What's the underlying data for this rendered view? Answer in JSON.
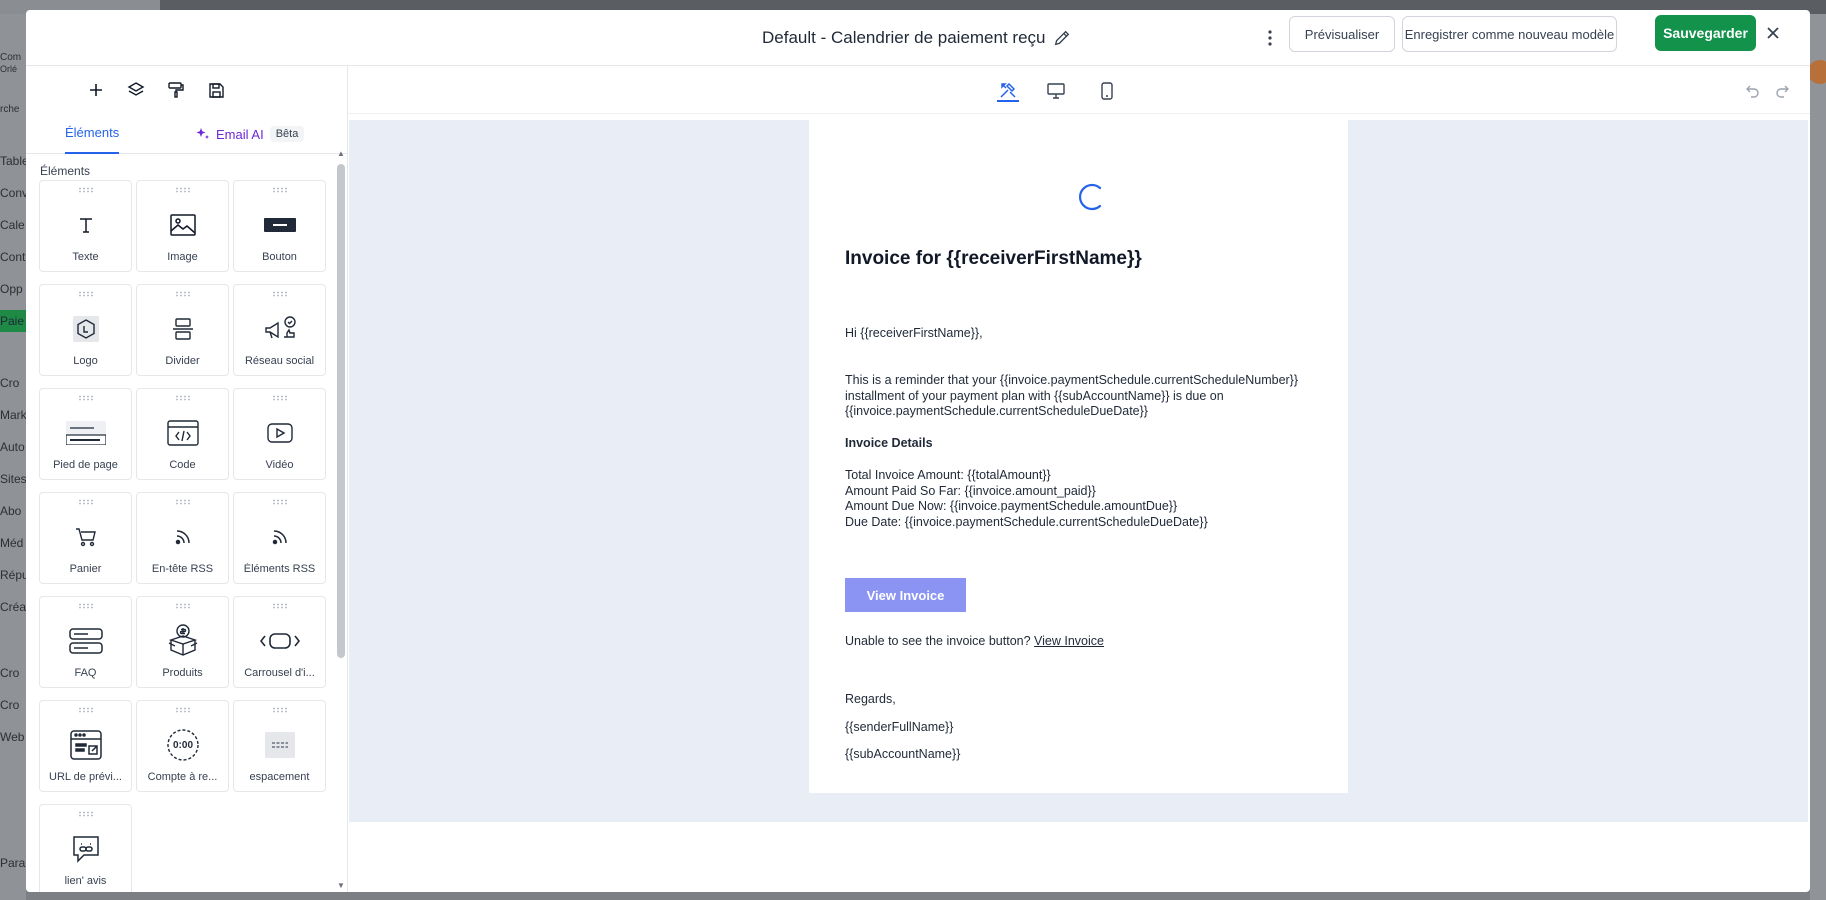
{
  "background": {
    "sidebar_fragments": [
      "Table",
      "Conv",
      "Cale",
      "Cont",
      "Opp",
      "Paie",
      "Cro",
      "Mark",
      "Auto",
      "Sites",
      "Abo",
      "Méd",
      "Répu",
      "Créa",
      "Cro",
      "Cro",
      "Web",
      "Para"
    ],
    "crumb": [
      "Com",
      "Orlé",
      "rche"
    ]
  },
  "header": {
    "title": "Default - Calendrier de paiement reçu",
    "preview_label": "Prévisualiser",
    "save_as_template_label": "Enregistrer comme nouveau modèle",
    "save_label": "Sauvegarder"
  },
  "left_panel": {
    "tab_elements": "Éléments",
    "tab_email_ai": "Email AI",
    "beta_badge": "Bêta",
    "section_label": "Éléments",
    "elements": [
      {
        "label": "Texte",
        "icon": "text-icon"
      },
      {
        "label": "Image",
        "icon": "image-icon"
      },
      {
        "label": "Bouton",
        "icon": "button-icon"
      },
      {
        "label": "Logo",
        "icon": "logo-icon"
      },
      {
        "label": "Divider",
        "icon": "divider-icon"
      },
      {
        "label": "Réseau social",
        "icon": "social-icon"
      },
      {
        "label": "Pied de page",
        "icon": "footer-icon"
      },
      {
        "label": "Code",
        "icon": "code-icon"
      },
      {
        "label": "Vidéo",
        "icon": "video-icon"
      },
      {
        "label": "Panier",
        "icon": "cart-icon"
      },
      {
        "label": "En-tête RSS",
        "icon": "rss-icon"
      },
      {
        "label": "Éléments RSS",
        "icon": "rss-icon"
      },
      {
        "label": "FAQ",
        "icon": "faq-icon"
      },
      {
        "label": "Produits",
        "icon": "products-icon"
      },
      {
        "label": "Carrousel d'i...",
        "icon": "carousel-icon"
      },
      {
        "label": "URL de prévi...",
        "icon": "preview-url-icon"
      },
      {
        "label": "Compte à re...",
        "icon": "countdown-icon"
      },
      {
        "label": "espacement",
        "icon": "spacer-icon"
      },
      {
        "label": "lien' avis",
        "icon": "review-link-icon"
      }
    ],
    "countdown_text": "0:00"
  },
  "email": {
    "title": "Invoice for {{receiverFirstName}}",
    "greeting": "Hi {{receiverFirstName}},",
    "reminder_line1": "This is a reminder that your {{invoice.paymentSchedule.currentScheduleNumber}}",
    "reminder_line2": "installment of your payment plan with {{subAccountName}} is due on",
    "reminder_line3": "{{invoice.paymentSchedule.currentScheduleDueDate}}",
    "details_heading": "Invoice Details",
    "detail_total": "Total Invoice Amount: {{totalAmount}}",
    "detail_paid": "Amount Paid So Far: {{invoice.amount_paid}}",
    "detail_due": "Amount Due Now: {{invoice.paymentSchedule.amountDue}}",
    "detail_date": "Due Date: {{invoice.paymentSchedule.currentScheduleDueDate}}",
    "button_label": "View Invoice",
    "fallback_text": "Unable to see the invoice button?",
    "fallback_link": "View Invoice",
    "regards": "Regards,",
    "sender": "{{senderFullName}}",
    "subaccount": "{{subAccountName}}"
  },
  "colors": {
    "accent": "#2563eb",
    "save_button": "#12924b",
    "email_button": "#8b93f3",
    "canvas_bg": "#e9eef6",
    "ai_purple": "#6d28d9"
  }
}
